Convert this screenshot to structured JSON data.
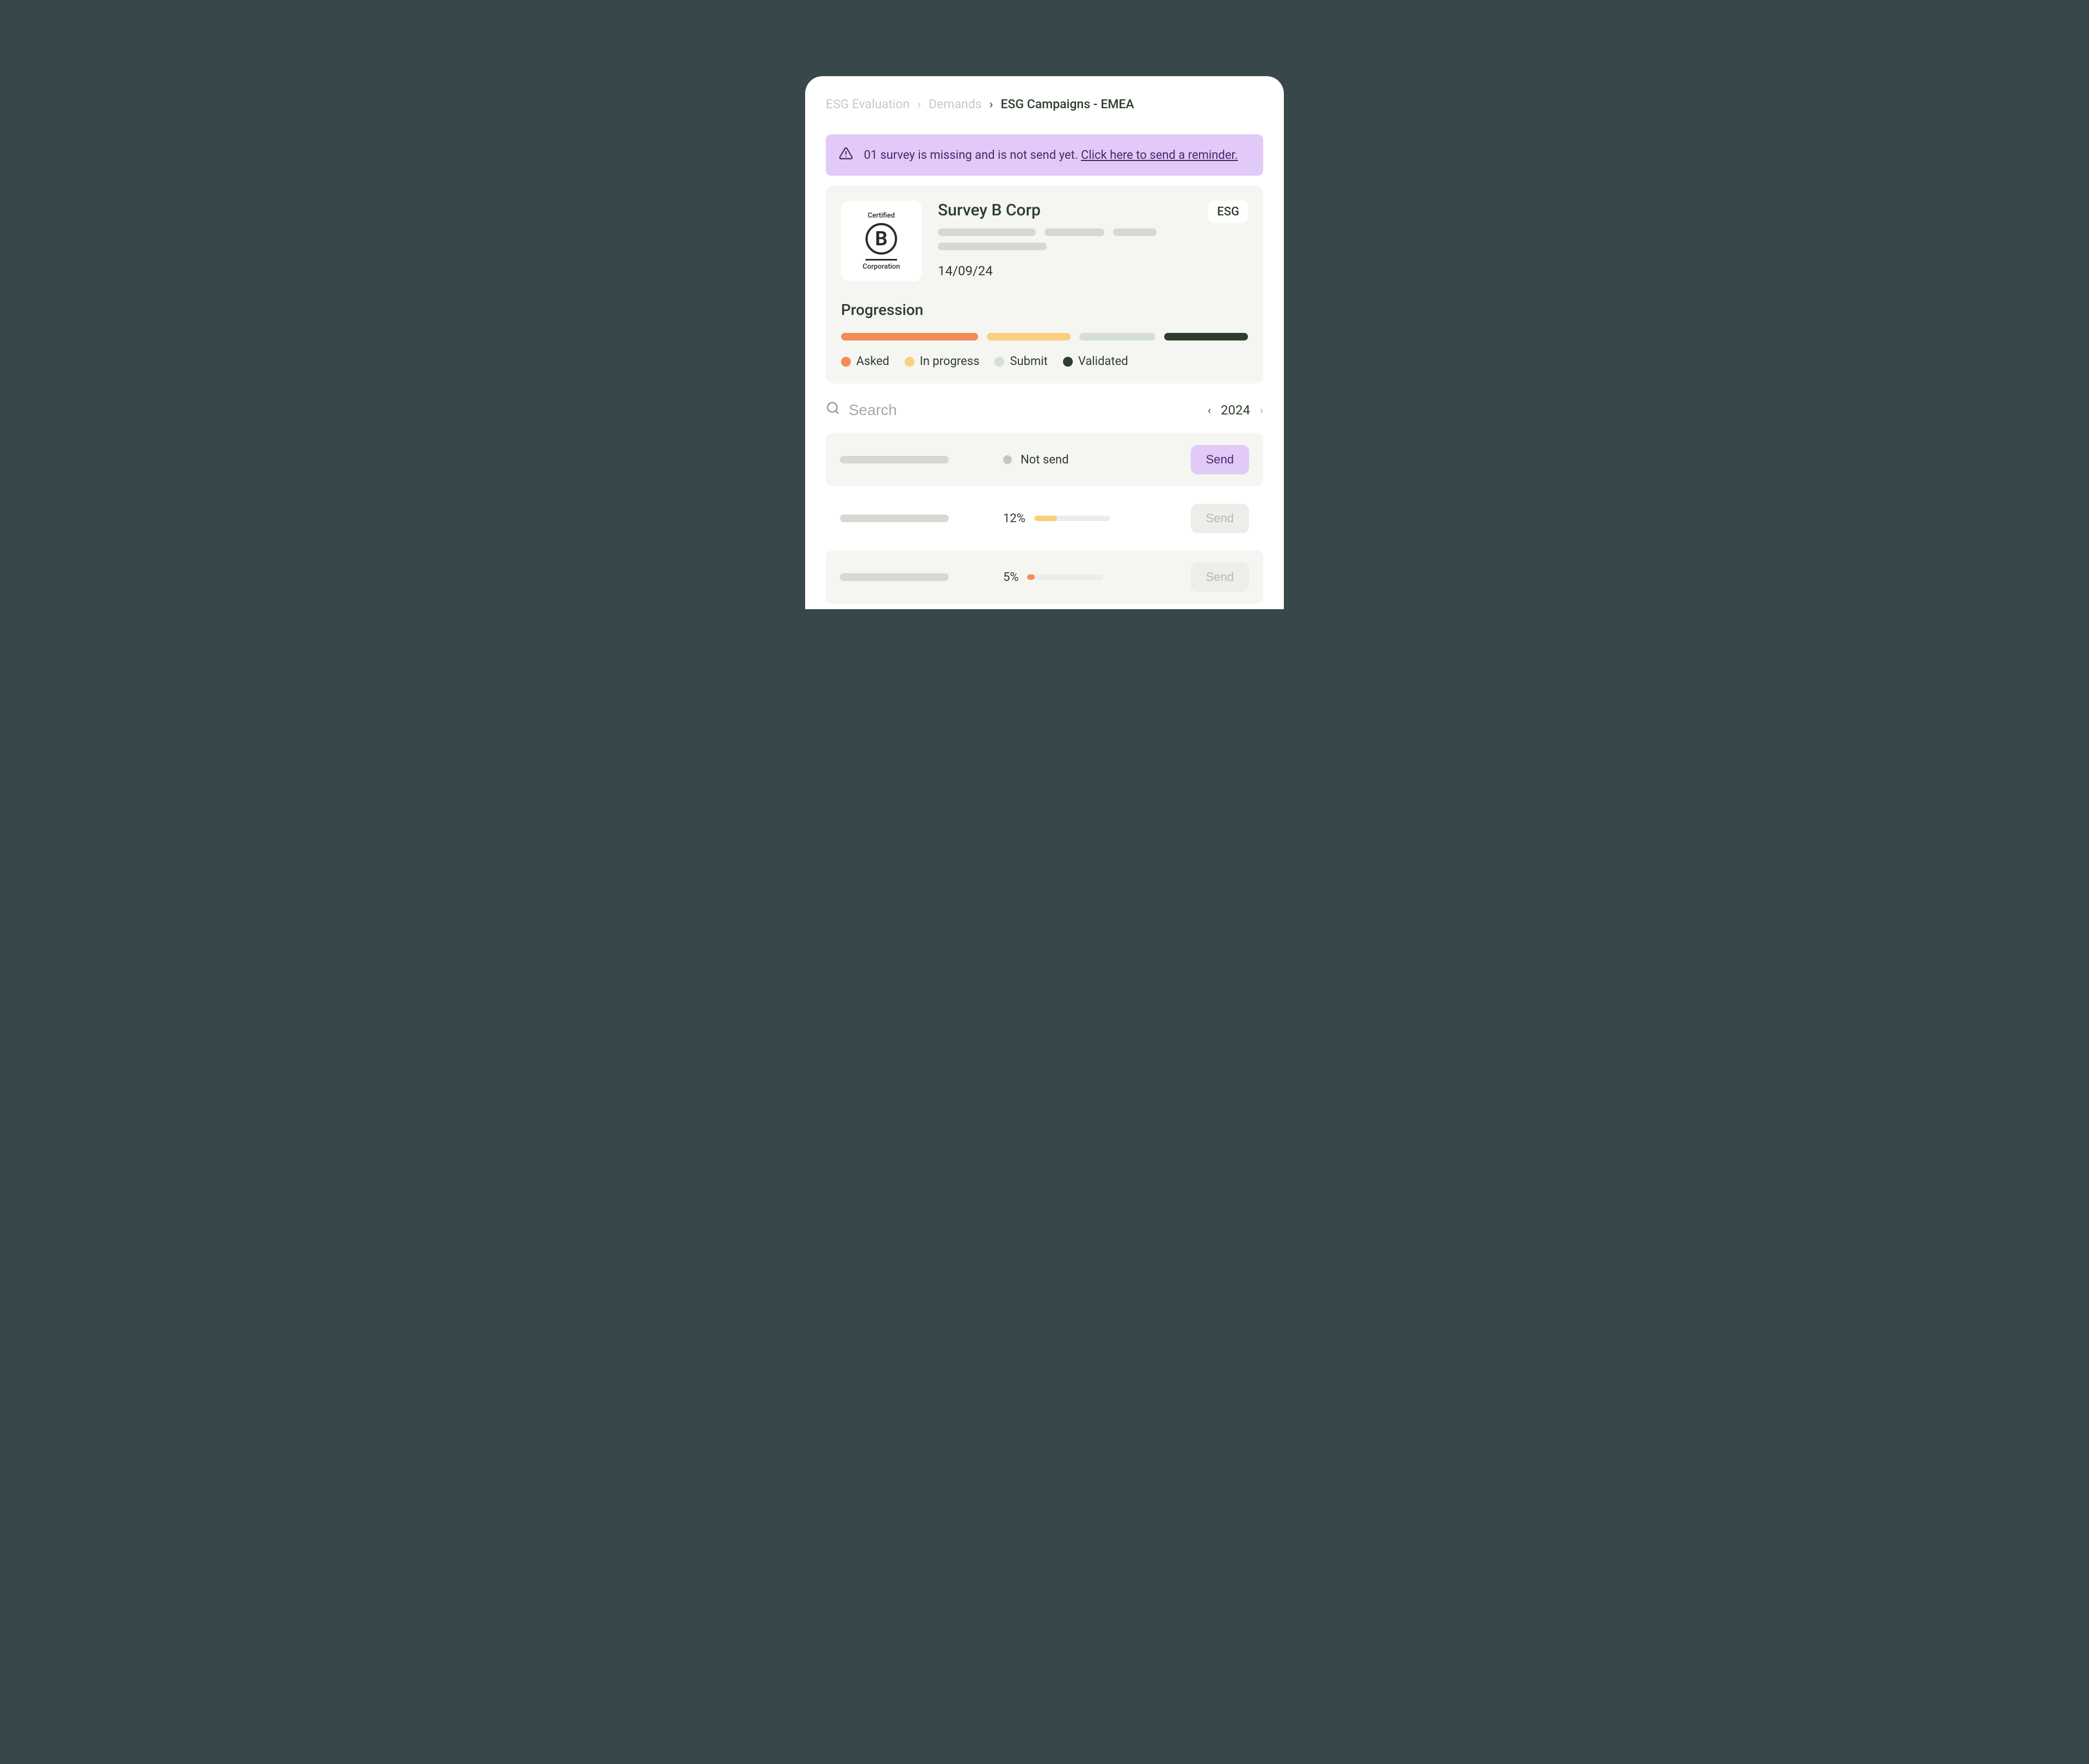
{
  "breadcrumb": {
    "items": [
      "ESG Evaluation",
      "Demands",
      "ESG Campaigns - EMEA"
    ]
  },
  "alert": {
    "text": "01 survey is missing and is not send yet. ",
    "link": "Click here to send a reminder."
  },
  "summary": {
    "logo": {
      "top": "Certified",
      "letter": "B",
      "bottom": "Corporation"
    },
    "title": "Survey B Corp",
    "badge": "ESG",
    "date": "14/09/24",
    "progression_title": "Progression",
    "legend": [
      {
        "label": "Asked",
        "color": "#f28b56"
      },
      {
        "label": "In progress",
        "color": "#f8d07e"
      },
      {
        "label": "Submit",
        "color": "#d5e0d2"
      },
      {
        "label": "Validated",
        "color": "#2f3e2c"
      }
    ],
    "bars": [
      {
        "color": "#f28b56",
        "width": 36
      },
      {
        "color": "#f8d07e",
        "width": 22
      },
      {
        "color": "#d5e0d2",
        "width": 20
      },
      {
        "color": "#2f3e2c",
        "width": 22
      }
    ]
  },
  "search": {
    "placeholder": "Search"
  },
  "year": {
    "value": "2024"
  },
  "rows": [
    {
      "status_label": "Not send",
      "status_type": "dot",
      "send_label": "Send",
      "send_enabled": true,
      "bg": "gray"
    },
    {
      "status_label": "12%",
      "status_type": "bar",
      "fill_pct": 30,
      "fill_color": "#f8d07e",
      "send_label": "Send",
      "send_enabled": false,
      "bg": "white"
    },
    {
      "status_label": "5%",
      "status_type": "bar",
      "fill_pct": 10,
      "fill_color": "#f28b56",
      "send_label": "Send",
      "send_enabled": false,
      "bg": "gray"
    }
  ],
  "colors": {
    "accent_purple": "#e1c9f8",
    "text_dark": "#2d3e2c"
  }
}
